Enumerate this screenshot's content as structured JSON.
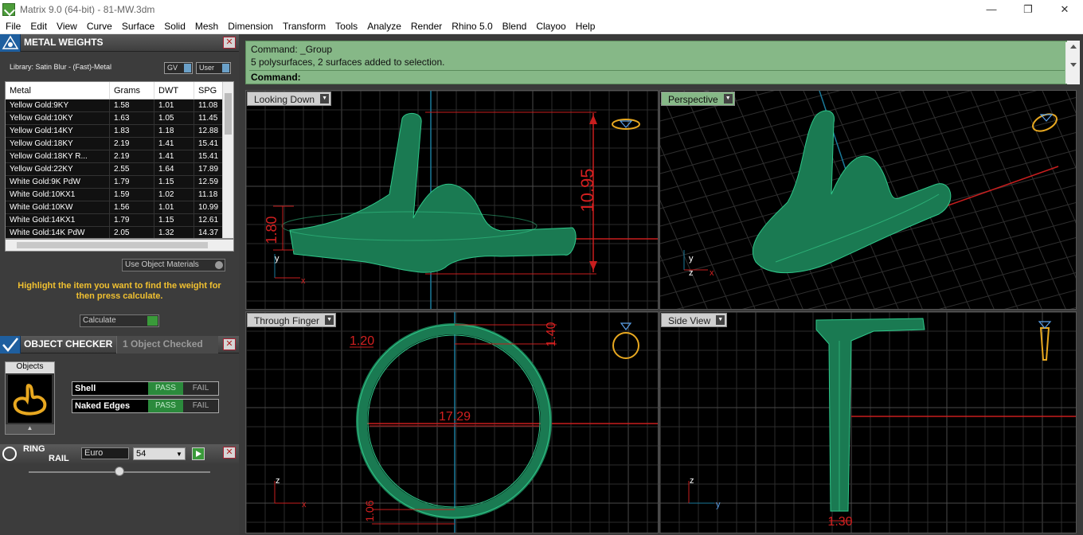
{
  "window": {
    "title": "Matrix 9.0 (64-bit) - 81-MW.3dm",
    "minimize": "—",
    "restore": "❐",
    "close": "✕"
  },
  "menu": [
    "File",
    "Edit",
    "View",
    "Curve",
    "Surface",
    "Solid",
    "Mesh",
    "Dimension",
    "Transform",
    "Tools",
    "Analyze",
    "Render",
    "Rhino 5.0",
    "Blend",
    "Clayoo",
    "Help"
  ],
  "metal_weights": {
    "title": "METAL WEIGHTS",
    "library": "Library: Satin Blur - (Fast)-Metal",
    "toggle_gv": "GV",
    "toggle_user": "User",
    "columns": [
      "Metal",
      "Grams",
      "DWT",
      "SPG"
    ],
    "rows": [
      [
        "Yellow Gold:9KY",
        "1.58",
        "1.01",
        "11.08"
      ],
      [
        "Yellow Gold:10KY",
        "1.63",
        "1.05",
        "11.45"
      ],
      [
        "Yellow Gold:14KY",
        "1.83",
        "1.18",
        "12.88"
      ],
      [
        "Yellow Gold:18KY",
        "2.19",
        "1.41",
        "15.41"
      ],
      [
        "Yellow Gold:18KY R...",
        "2.19",
        "1.41",
        "15.41"
      ],
      [
        "Yellow Gold:22KY",
        "2.55",
        "1.64",
        "17.89"
      ],
      [
        "White Gold:9K PdW",
        "1.79",
        "1.15",
        "12.59"
      ],
      [
        "White Gold:10KX1",
        "1.59",
        "1.02",
        "11.18"
      ],
      [
        "White Gold:10KW",
        "1.56",
        "1.01",
        "10.99"
      ],
      [
        "White Gold:14KX1",
        "1.79",
        "1.15",
        "12.61"
      ],
      [
        "White Gold:14K PdW",
        "2.05",
        "1.32",
        "14.37"
      ]
    ],
    "use_object_materials": "Use Object Materials",
    "hint": "Highlight the item you want to find the weight for then press calculate.",
    "calculate": "Calculate"
  },
  "object_checker": {
    "title": "OBJECT CHECKER",
    "count": "1  Object Checked",
    "objects_label": "Objects",
    "checks": [
      {
        "label": "Shell",
        "pass": "PASS",
        "fail": "FAIL"
      },
      {
        "label": "Naked Edges",
        "pass": "PASS",
        "fail": "FAIL"
      }
    ]
  },
  "ring_rail": {
    "title_line1": "RING",
    "title_line2": "RAIL",
    "standard": "Euro",
    "size": "54"
  },
  "command": {
    "line1": "Command: _Group",
    "line2": "5 polysurfaces, 2 surfaces added to selection.",
    "prompt": "Command:"
  },
  "viewports": {
    "top_left": "Looking Down",
    "top_right": "Perspective",
    "bottom_left": "Through Finger",
    "bottom_right": "Side View"
  },
  "dimensions": {
    "height": "10.95",
    "band_height": "1.80",
    "top_width": "1.20",
    "top_thickness": "1.40",
    "diameter": "17.29",
    "bottom_thickness": "1.06",
    "side_width": "1.30"
  },
  "axes": {
    "x": "x",
    "y": "y",
    "z": "z"
  },
  "colors": {
    "model": "#1a7a52",
    "dimension": "#d42020",
    "grid": "#3a3a3a",
    "axis_blue": "#1a7a9a",
    "command_bg": "#86b887"
  }
}
